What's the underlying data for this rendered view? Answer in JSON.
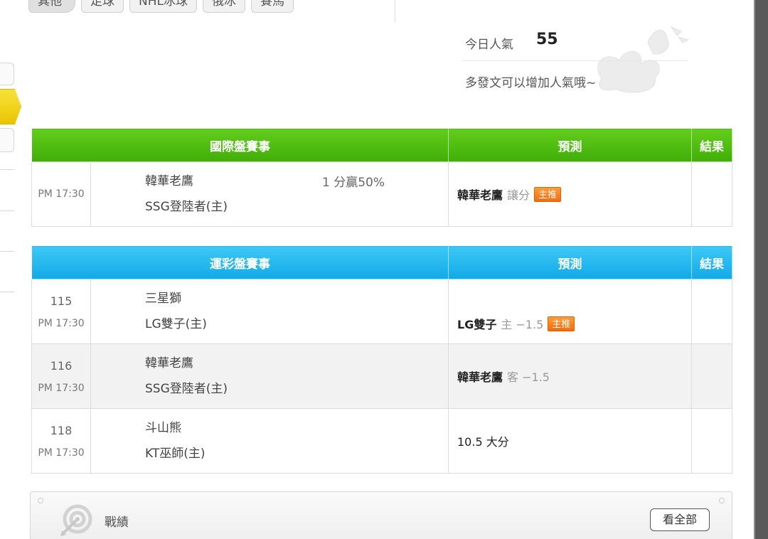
{
  "top_tags": [
    "其他",
    "足球",
    "NHL冰球",
    "俄冰",
    "賽馬"
  ],
  "popularity": {
    "label": "今日人氣",
    "value": "55",
    "hint": "多發文可以增加人氣哦~"
  },
  "colors": {
    "green_header": "#4cbc10",
    "blue_header": "#1eb2ee",
    "badge": "#f57a1c"
  },
  "intl_table": {
    "headers": {
      "match": "國際盤賽事",
      "prediction": "預測",
      "result": "結果"
    },
    "rows": [
      {
        "time": "PM 17:30",
        "away": "韓華老鷹",
        "home": "SSG登陸者(主)",
        "odds": "1 分贏50%",
        "pick": "韓華老鷹",
        "pick_detail": "讓分",
        "badge": "主推",
        "result": ""
      }
    ]
  },
  "lottery_table": {
    "headers": {
      "match": "運彩盤賽事",
      "prediction": "預測",
      "result": "結果"
    },
    "rows": [
      {
        "num": "115",
        "time": "PM 17:30",
        "away": "三星獅",
        "home": "LG雙子(主)",
        "pick": "LG雙子",
        "pick_detail": "主 −1.5",
        "badge": "主推",
        "result": ""
      },
      {
        "num": "116",
        "time": "PM 17:30",
        "away": "韓華老鷹",
        "home": "SSG登陸者(主)",
        "pick": "韓華老鷹",
        "pick_detail": "客 −1.5",
        "badge": "",
        "result": ""
      },
      {
        "num": "118",
        "time": "PM 17:30",
        "away": "斗山熊",
        "home": "KT巫師(主)",
        "pick": "10.5 大分",
        "pick_detail": "",
        "badge": "",
        "result": ""
      }
    ]
  },
  "record_panel": {
    "title": "戰績",
    "button": "看全部",
    "icon": "target-icon"
  }
}
